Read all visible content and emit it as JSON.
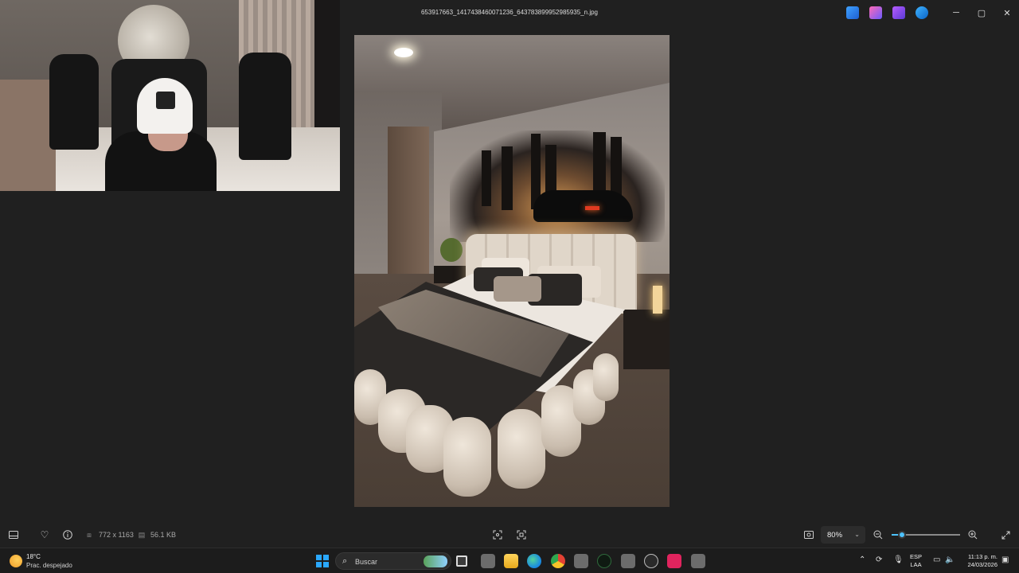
{
  "window": {
    "title": "653917663_1417438460071236_643783899952985935_n.jpg",
    "minimize_glyph": "─",
    "maximize_glyph": "▢",
    "close_glyph": "✕"
  },
  "toolbar": {
    "dimensions": "772 x 1163",
    "file_size": "56.1 KB",
    "zoom_level": "80%",
    "zoom_fraction": 0.15
  },
  "taskbar": {
    "weather_temp": "18°C",
    "weather_desc": "Prac. despejado",
    "search_placeholder": "Buscar",
    "lang_line1": "ESP",
    "lang_line2": "LAA",
    "time": "11:13 p. m.",
    "date": "24/03/2026"
  },
  "colors": {
    "accent": "#4cc2ff",
    "background": "#202020",
    "taskbar": "#1c1c1c"
  },
  "icons": [
    "filmstrip-icon",
    "heart-icon",
    "info-icon",
    "dimensions-icon",
    "save-icon",
    "fit-icon",
    "crop-icon",
    "screenshot-icon",
    "zoom-out-icon",
    "zoom-in-icon",
    "fullscreen-icon"
  ]
}
